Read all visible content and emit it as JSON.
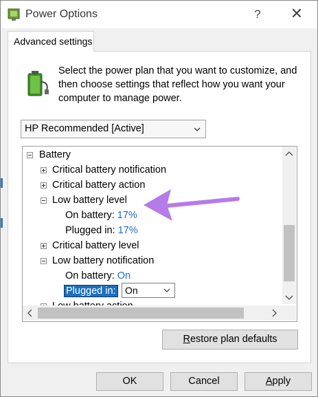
{
  "window": {
    "title": "Power Options",
    "help_glyph": "?",
    "close_glyph": "✕"
  },
  "tab": {
    "label": "Advanced settings"
  },
  "description": "Select the power plan that you want to customize, and then choose settings that reflect how you want your computer to manage power.",
  "plan_select": {
    "value": "HP Recommended [Active]"
  },
  "tree": {
    "battery": "Battery",
    "critical_notification": "Critical battery notification",
    "critical_action": "Critical battery action",
    "low_level": "Low battery level",
    "low_level_on_battery_label": "On battery:",
    "low_level_on_battery_value": "17%",
    "low_level_plugged_label": "Plugged in:",
    "low_level_plugged_value": "17%",
    "critical_level": "Critical battery level",
    "low_notification": "Low battery notification",
    "low_notification_on_battery_label": "On battery:",
    "low_notification_on_battery_value": "On",
    "low_notification_plugged_label": "Plugged in:",
    "low_notification_plugged_value": "On",
    "low_action": "Low battery action"
  },
  "buttons": {
    "restore_first": "R",
    "restore_rest": "estore plan defaults",
    "ok": "OK",
    "cancel": "Cancel",
    "apply_first": "A",
    "apply_rest": "pply"
  },
  "colors": {
    "accent": "#1c6fc1",
    "annotation_arrow": "#b57be8"
  }
}
